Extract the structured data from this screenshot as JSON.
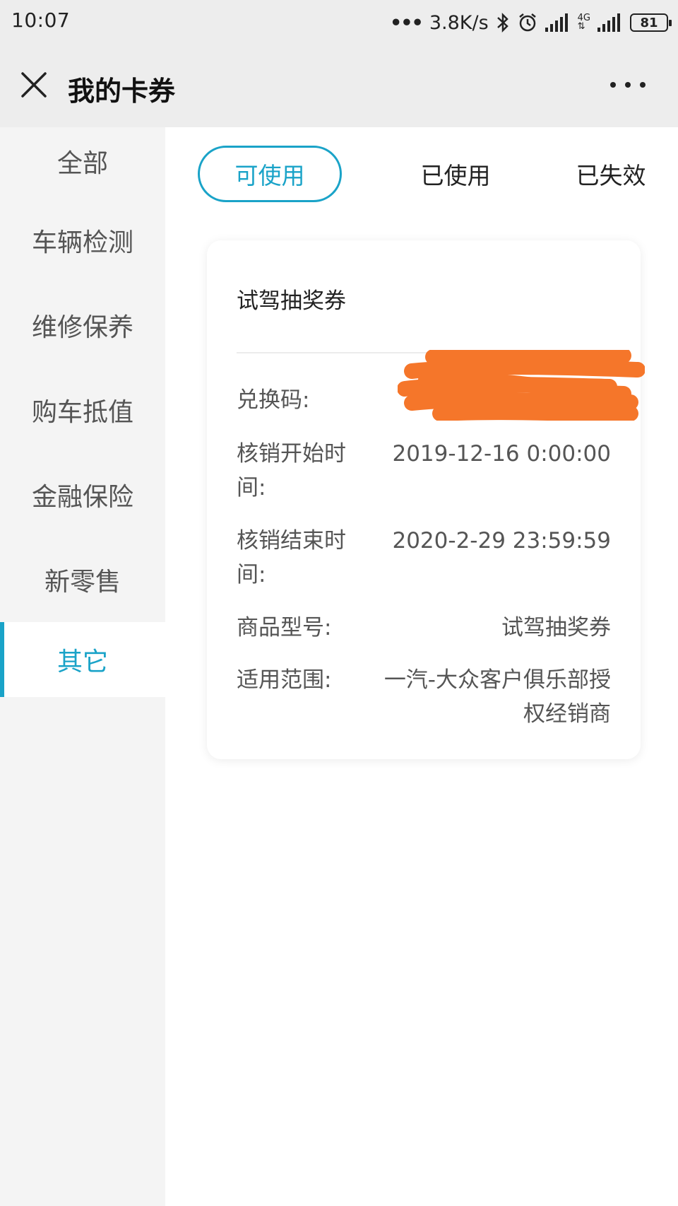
{
  "status_bar": {
    "time": "10:07",
    "network_speed": "3.8K/s",
    "network_type": "4G",
    "battery": "81"
  },
  "header": {
    "title": "我的卡券",
    "close_icon": "close-icon",
    "more_icon": "more-horizontal-icon"
  },
  "sidebar": {
    "items": [
      {
        "label": "全部"
      },
      {
        "label": "车辆检测"
      },
      {
        "label": "维修保养"
      },
      {
        "label": "购车抵值"
      },
      {
        "label": "金融保险"
      },
      {
        "label": "新零售"
      },
      {
        "label": "其它"
      }
    ],
    "active_index": 6
  },
  "tabs": [
    {
      "label": "可使用"
    },
    {
      "label": "已使用"
    },
    {
      "label": "已失效"
    }
  ],
  "coupon": {
    "title": "试驾抽奖券",
    "rows": [
      {
        "label": "兑换码:",
        "value": ""
      },
      {
        "label": "核销开始时间:",
        "value": "2019-12-16 0:00:00"
      },
      {
        "label": "核销结束时间:",
        "value": "2020-2-29 23:59:59"
      },
      {
        "label": "商品型号:",
        "value": "试驾抽奖券"
      },
      {
        "label": "适用范围:",
        "value": "一汽-大众客户俱乐部授权经销商"
      }
    ]
  },
  "colors": {
    "accent": "#1aa3c8",
    "redaction": "#f5762a",
    "bar_bg": "#ededed",
    "sidebar_bg": "#f4f4f4"
  }
}
